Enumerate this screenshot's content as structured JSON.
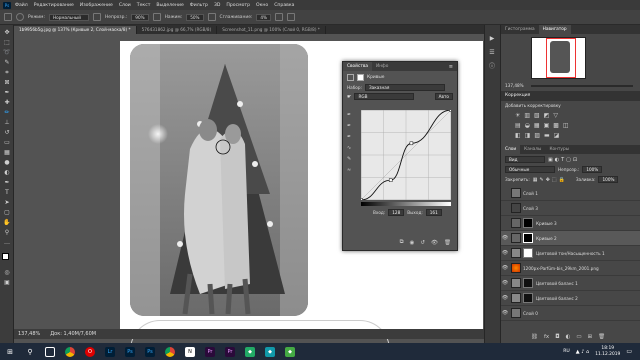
{
  "menubar": {
    "app_icon": "Ps",
    "items": [
      "Файл",
      "Редактирование",
      "Изображение",
      "Слои",
      "Текст",
      "Выделение",
      "Фильтр",
      "3D",
      "Просмотр",
      "Окно",
      "Справка"
    ]
  },
  "options_bar": {
    "mode_label": "Режим:",
    "mode_value": "Нормальный",
    "opacity_label": "Непрозр.:",
    "opacity_value": "90%",
    "flow_label": "Нажим:",
    "flow_value": "50%",
    "smooth_label": "Сглаживание:",
    "smooth_value": "4%"
  },
  "tabs": [
    {
      "label": "1b9956b5g.jpg @ 137% (Кривые 2, Слой-маска/8) *",
      "active": true
    },
    {
      "label": "576431862.jpg @ 66,7% (RGB/8)",
      "active": false
    },
    {
      "label": "Screenshot_11.png @ 100% (Слой 0, RGB/8) *",
      "active": false
    }
  ],
  "statusbar": {
    "zoom": "137,48%",
    "doc": "Док: 1,40M/7,60M"
  },
  "dock_top": {
    "tabs": [
      "Гистограмма",
      "Навигатор"
    ],
    "zoom": "137,48%"
  },
  "corrections": {
    "title": "Коррекция",
    "subtitle": "Добавить корректировку"
  },
  "layers_panel": {
    "tabs": [
      "Слои",
      "Каналы",
      "Контуры"
    ],
    "kind": "Вид",
    "blend": "Обычные",
    "opacity_label": "Непрозр.:",
    "opacity_value": "100%",
    "lock_label": "Закрепить:",
    "fill_label": "Заливка:",
    "fill_value": "100%",
    "layers": [
      {
        "name": "Слой 1",
        "visible": false
      },
      {
        "name": "Слой 3",
        "visible": false
      },
      {
        "name": "Кривые 3",
        "visible": false
      },
      {
        "name": "Кривые 2",
        "visible": true,
        "active": true
      },
      {
        "name": "Цветовой тон/Насыщенность 1",
        "visible": true
      },
      {
        "name": "1200px-Parfüm-bis_29km_2001.png",
        "visible": true
      },
      {
        "name": "Цветовой баланс 1",
        "visible": true
      },
      {
        "name": "Цветовой баланс 2",
        "visible": true
      },
      {
        "name": "Слой 0",
        "visible": true
      }
    ]
  },
  "properties": {
    "tabs": [
      "Свойства",
      "Инфо"
    ],
    "adj_name": "Кривые",
    "preset_label": "Набор:",
    "preset_value": "Заказная",
    "channel_value": "RGB",
    "auto_label": "Авто",
    "input_label": "Вход:",
    "input_value": "128",
    "output_label": "Выход:",
    "output_value": "161"
  },
  "curve_points": [
    [
      0,
      0
    ],
    [
      0.33,
      0.22
    ],
    [
      0.56,
      0.63
    ],
    [
      1,
      1
    ]
  ],
  "taskbar": {
    "items": [
      "start",
      "search",
      "taskview",
      "chrome",
      "opera",
      "lr",
      "ps",
      "ps2",
      "chrome2",
      "notion",
      "pr",
      "pr2",
      "app",
      "app2",
      "app3"
    ],
    "lang": "RU",
    "time": "18:19",
    "date": "11.12.2019"
  },
  "colors": {
    "accent": "#31a8ff",
    "panel": "#535353",
    "dark": "#3a3a3a",
    "taskbar": "#1f2a3a"
  }
}
